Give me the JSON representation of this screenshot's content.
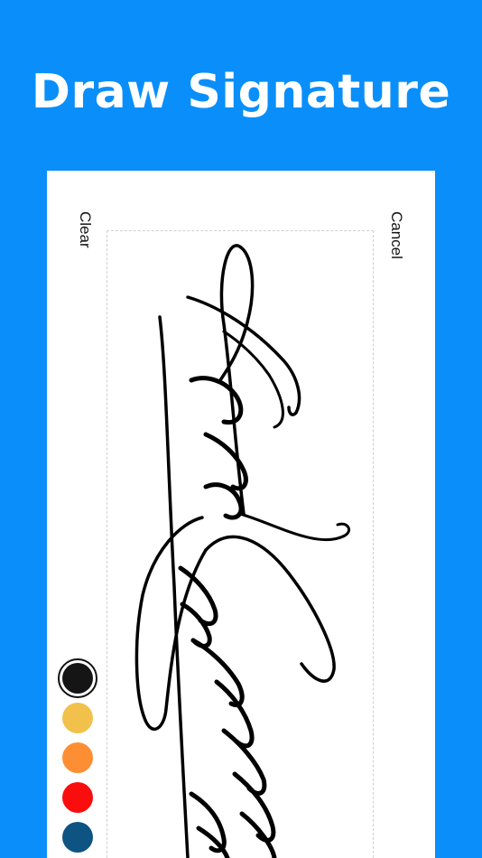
{
  "header": {
    "title": "Draw Signature"
  },
  "toolbar": {
    "clear_label": "Clear",
    "cancel_label": "Cancel"
  },
  "palette": {
    "selected": "black",
    "colors": [
      {
        "name": "black",
        "hex": "#151515"
      },
      {
        "name": "yellow",
        "hex": "#f1c14b"
      },
      {
        "name": "orange",
        "hex": "#fe8e33"
      },
      {
        "name": "red",
        "hex": "#f90e0d"
      },
      {
        "name": "navy",
        "hex": "#0d5482"
      }
    ]
  },
  "canvas": {
    "stroke_color": "#000000"
  }
}
